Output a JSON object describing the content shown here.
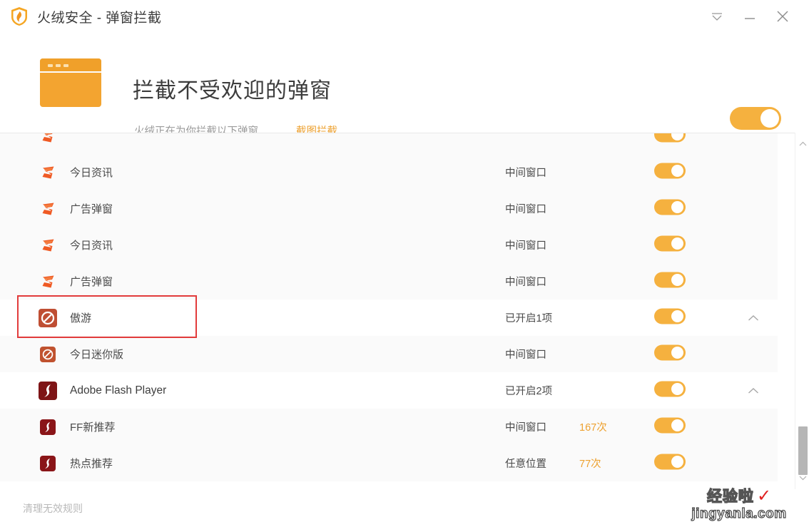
{
  "window": {
    "title": "火绒安全 - 弹窗拦截",
    "logo_icon": "huorong-shield-icon",
    "controls": [
      {
        "name": "menu-collapse-button",
        "icon": "chevron-down-underline-icon"
      },
      {
        "name": "minimize-button",
        "icon": "minimize-icon"
      },
      {
        "name": "close-button",
        "icon": "close-icon"
      }
    ]
  },
  "banner": {
    "icon": "popup-window-icon",
    "title": "拦截不受欢迎的弹窗",
    "subtitle": "火绒正在为你拦截以下弹窗",
    "link": "截图拦截",
    "master_toggle_on": true,
    "accent_color": "#f5b13f",
    "link_color": "#eda130"
  },
  "list": {
    "rows": [
      {
        "id": "row-partial-top",
        "icon": "sogou-icon",
        "icon_type": "sogou",
        "label": "",
        "position": "",
        "count": "",
        "toggle_on": true,
        "level": "child",
        "chevron": "",
        "partial": true
      },
      {
        "id": "row-sogou-news-1",
        "icon": "sogou-icon",
        "icon_type": "sogou",
        "label": "今日资讯",
        "position": "中间窗口",
        "count": "",
        "toggle_on": true,
        "level": "child",
        "chevron": ""
      },
      {
        "id": "row-sogou-ad-1",
        "icon": "sogou-icon",
        "icon_type": "sogou",
        "label": "广告弹窗",
        "position": "中间窗口",
        "count": "",
        "toggle_on": true,
        "level": "child",
        "chevron": ""
      },
      {
        "id": "row-sogou-news-2",
        "icon": "sogou-icon",
        "icon_type": "sogou",
        "label": "今日资讯",
        "position": "中间窗口",
        "count": "",
        "toggle_on": true,
        "level": "child",
        "chevron": ""
      },
      {
        "id": "row-sogou-ad-2",
        "icon": "sogou-icon",
        "icon_type": "sogou",
        "label": "广告弹窗",
        "position": "中间窗口",
        "count": "",
        "toggle_on": true,
        "level": "child",
        "chevron": ""
      },
      {
        "id": "row-maxthon",
        "icon": "maxthon-block-icon",
        "icon_type": "maxthon",
        "label": "傲游",
        "position": "已开启1项",
        "count": "",
        "toggle_on": true,
        "level": "parent",
        "chevron": "chevron-up-icon",
        "highlighted": true
      },
      {
        "id": "row-maxthon-mini",
        "icon": "maxthon-block-icon",
        "icon_type": "maxthon-small",
        "label": "今日迷你版",
        "position": "中间窗口",
        "count": "",
        "toggle_on": true,
        "level": "child",
        "chevron": ""
      },
      {
        "id": "row-flash",
        "icon": "flash-player-icon",
        "icon_type": "flash",
        "label": "Adobe Flash Player",
        "position": "已开启2项",
        "count": "",
        "toggle_on": true,
        "level": "parent",
        "chevron": "chevron-up-icon"
      },
      {
        "id": "row-flash-ff",
        "icon": "flash-player-icon",
        "icon_type": "flash-small",
        "label": "FF新推荐",
        "position": "中间窗口",
        "count": "167次",
        "toggle_on": true,
        "level": "child",
        "chevron": ""
      },
      {
        "id": "row-flash-hot",
        "icon": "flash-player-icon",
        "icon_type": "flash-small",
        "label": "热点推荐",
        "position": "任意位置",
        "count": "77次",
        "toggle_on": true,
        "level": "child",
        "chevron": ""
      }
    ]
  },
  "scrollbar": {
    "up_icon": "chevron-up-icon",
    "down_icon": "chevron-down-icon"
  },
  "footer": {
    "clear_rules_label": "清理无效规则"
  },
  "annotation": {
    "color": "#e23b3b",
    "target": "row-maxthon"
  },
  "watermark": {
    "cn": "经验啦",
    "check": "✓",
    "en": "jingyanla.com"
  }
}
